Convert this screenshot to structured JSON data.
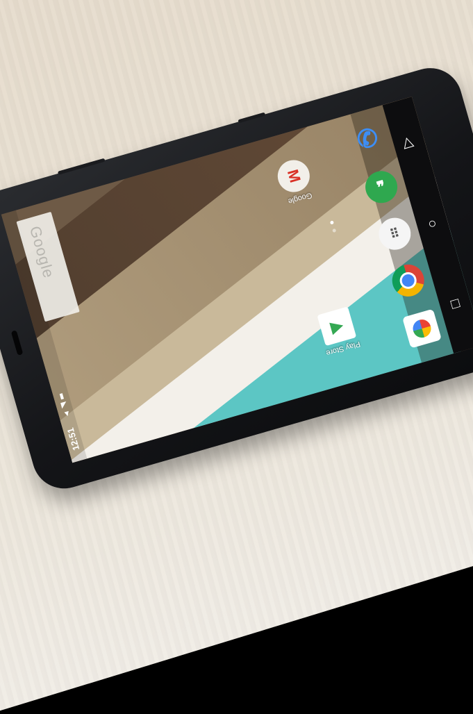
{
  "status_bar": {
    "time": "12:51"
  },
  "search": {
    "label": "Google"
  },
  "apps": [
    {
      "label": "Google",
      "icon": "gmail-icon"
    },
    {
      "label": "Play Store",
      "icon": "play-store-icon"
    }
  ],
  "dock": [
    {
      "icon": "phone-icon"
    },
    {
      "icon": "hangouts-icon"
    },
    {
      "icon": "app-drawer-icon"
    },
    {
      "icon": "chrome-icon"
    },
    {
      "icon": "photos-icon"
    }
  ],
  "colors": {
    "wallpaper_teal": "#5cc6c4",
    "wallpaper_brown": "#6a4f3a",
    "table": "#e9e1d4"
  }
}
